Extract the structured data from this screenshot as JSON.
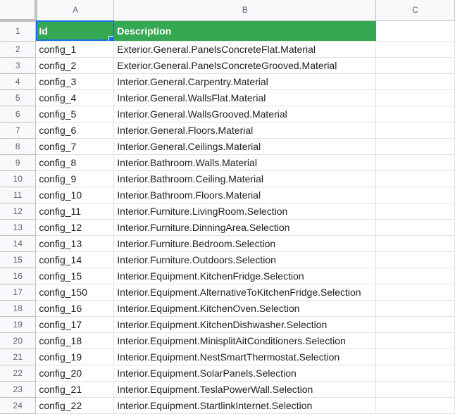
{
  "columns": [
    "A",
    "B",
    "C"
  ],
  "header_row": {
    "row_num": "1",
    "id": "Id",
    "description": "Description"
  },
  "rows": [
    {
      "n": "2",
      "id": "config_1",
      "desc": "Exterior.General.PanelsConcreteFlat.Material"
    },
    {
      "n": "3",
      "id": "config_2",
      "desc": "Exterior.General.PanelsConcreteGrooved.Material"
    },
    {
      "n": "4",
      "id": "config_3",
      "desc": "Interior.General.Carpentry.Material"
    },
    {
      "n": "5",
      "id": "config_4",
      "desc": "Interior.General.WallsFlat.Material"
    },
    {
      "n": "6",
      "id": "config_5",
      "desc": "Interior.General.WallsGrooved.Material"
    },
    {
      "n": "7",
      "id": "config_6",
      "desc": "Interior.General.Floors.Material"
    },
    {
      "n": "8",
      "id": "config_7",
      "desc": "Interior.General.Ceilings.Material"
    },
    {
      "n": "9",
      "id": "config_8",
      "desc": "Interior.Bathroom.Walls.Material"
    },
    {
      "n": "10",
      "id": "config_9",
      "desc": "Interior.Bathroom.Ceiling.Material"
    },
    {
      "n": "11",
      "id": "config_10",
      "desc": "Interior.Bathroom.Floors.Material"
    },
    {
      "n": "12",
      "id": "config_11",
      "desc": "Interior.Furniture.LivingRoom.Selection"
    },
    {
      "n": "13",
      "id": "config_12",
      "desc": "Interior.Furniture.DinningArea.Selection"
    },
    {
      "n": "14",
      "id": "config_13",
      "desc": "Interior.Furniture.Bedroom.Selection"
    },
    {
      "n": "15",
      "id": "config_14",
      "desc": "Interior.Furniture.Outdoors.Selection"
    },
    {
      "n": "16",
      "id": "config_15",
      "desc": "Interior.Equipment.KitchenFridge.Selection"
    },
    {
      "n": "17",
      "id": "config_150",
      "desc": "Interior.Equipment.AlternativeToKitchenFridge.Selection"
    },
    {
      "n": "18",
      "id": "config_16",
      "desc": "Interior.Equipment.KitchenOven.Selection"
    },
    {
      "n": "19",
      "id": "config_17",
      "desc": "Interior.Equipment.KitchenDishwasher.Selection"
    },
    {
      "n": "20",
      "id": "config_18",
      "desc": "Interior.Equipment.MinisplitAitConditioners.Selection"
    },
    {
      "n": "21",
      "id": "config_19",
      "desc": "Interior.Equipment.NestSmartThermostat.Selection"
    },
    {
      "n": "22",
      "id": "config_20",
      "desc": "Interior.Equipment.SolarPanels.Selection"
    },
    {
      "n": "23",
      "id": "config_21",
      "desc": "Interior.Equipment.TeslaPowerWall.Selection"
    },
    {
      "n": "24",
      "id": "config_22",
      "desc": "Interior.Equipment.StartlinkInternet.Selection"
    }
  ],
  "colors": {
    "header_green": "#34a853",
    "selection_blue": "#1a73e8"
  }
}
